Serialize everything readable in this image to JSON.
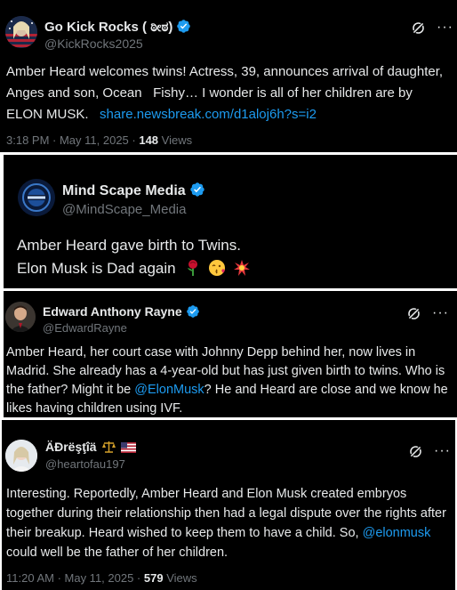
{
  "tweet1": {
    "name": "Go Kick Rocks ( ಠೀಠ)",
    "handle": "@KickRocks2025",
    "text": "Amber Heard welcomes twins! Actress, 39, announces arrival of daughter, Anges and son, Ocean   Fishy… I wonder is all of her children are by ELON MUSK.",
    "link": "share.newsbreak.com/d1aloj6h?s=i2",
    "time": "3:18 PM · May 11, 2025 · ",
    "views_count": "148",
    "views_label": " Views",
    "more": "···"
  },
  "tweet2": {
    "name": "Mind Scape Media",
    "handle": "@MindScape_Media",
    "line1": "Amber Heard gave birth to Twins.",
    "line2": "Elon Musk is Dad again",
    "emojis": [
      "rose-emoji",
      "kiss-face-emoji",
      "collision-emoji"
    ]
  },
  "tweet3": {
    "name": "Edward Anthony Rayne",
    "handle": "@EdwardRayne",
    "text_before": "Amber Heard, her court case with Johnny Depp behind her, now lives in Madrid. She already has a 4-year-old but has just given birth to twins. Who is the father? Might it be ",
    "mention": "@ElonMusk",
    "text_after": "? He and Heard are close and we know he likes having children using IVF.",
    "more": "···"
  },
  "tweet4": {
    "name": "ÄÐrëşţîä",
    "handle": "@heartofau197",
    "text_before": "Interesting. Reportedly, Amber Heard and Elon Musk created embryos together during their relationship then had a legal dispute over the rights after their breakup. Heard wished to keep them to have a child. So, ",
    "mention": "@elonmusk",
    "text_after": " could well be the father of her children.",
    "time": "11:20 AM · May 11, 2025 · ",
    "views_count": "579",
    "views_label": " Views",
    "more": "···"
  },
  "colors": {
    "background": "#000000",
    "text": "#e7e9ea",
    "muted": "#71767b",
    "link": "#1d9bf0",
    "verified": "#1d9bf0"
  }
}
